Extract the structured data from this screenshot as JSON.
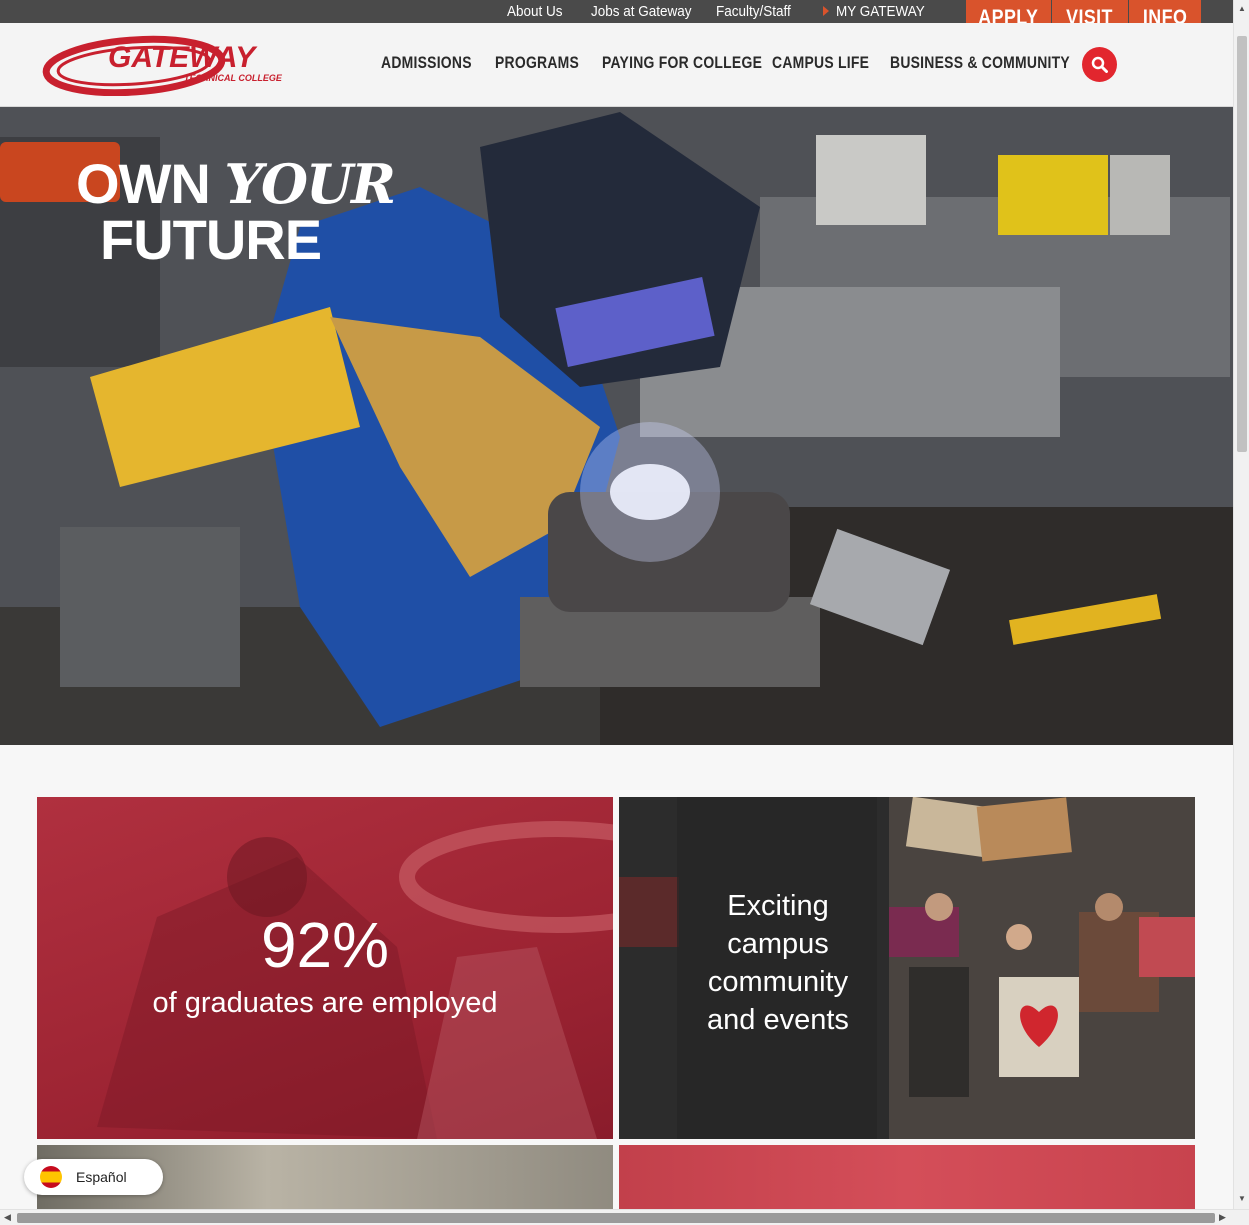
{
  "utility_nav": {
    "about": "About Us",
    "jobs": "Jobs at Gateway",
    "faculty": "Faculty/Staff",
    "my_gateway": "MY GATEWAY"
  },
  "cta": {
    "apply": "APPLY",
    "visit": "VISIT",
    "info": "INFO"
  },
  "logo": {
    "name": "GATEWAY",
    "tagline": "TECHNICAL COLLEGE"
  },
  "main_nav": [
    {
      "label": "ADMISSIONS"
    },
    {
      "label": "PROGRAMS"
    },
    {
      "label": "PAYING FOR COLLEGE"
    },
    {
      "label": "CAMPUS LIFE"
    },
    {
      "label": "BUSINESS & COMMUNITY"
    }
  ],
  "search": {
    "icon": "search-icon"
  },
  "hero": {
    "line1_a": "OWN",
    "line1_b": "YOUR",
    "line2": "FUTURE"
  },
  "tiles": {
    "stat_number": "92%",
    "stat_caption": "of graduates are employed",
    "events_line1": "Exciting",
    "events_line2": "campus",
    "events_line3": "community",
    "events_line4": "and events"
  },
  "language": {
    "label": "Español"
  },
  "colors": {
    "brand_red": "#e2262e",
    "cta_orange": "#d9532c",
    "tile_red": "#9d2433",
    "utility_bar": "#4a4a4a"
  }
}
